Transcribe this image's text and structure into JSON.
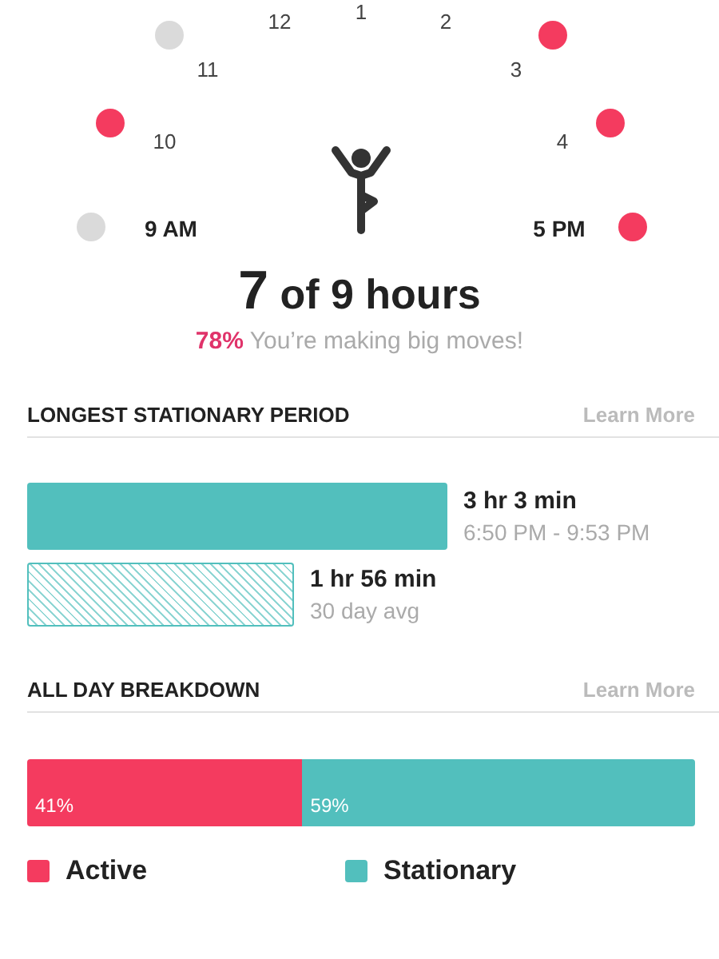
{
  "dial": {
    "hours": [
      {
        "label": "1",
        "kind": "plain"
      },
      {
        "label": "12",
        "kind": "plain"
      },
      {
        "label": "2",
        "kind": "plain"
      },
      {
        "label": "11",
        "kind": "plain"
      },
      {
        "label": "3",
        "kind": "plain"
      },
      {
        "label": "10",
        "kind": "plain"
      },
      {
        "label": "4",
        "kind": "plain"
      },
      {
        "label": "9 AM",
        "kind": "end"
      },
      {
        "label": "5 PM",
        "kind": "end"
      }
    ],
    "dots": [
      {
        "active": false
      },
      {
        "active": true
      },
      {
        "active": false
      },
      {
        "active": true
      },
      {
        "active": true
      },
      {
        "active": true
      }
    ]
  },
  "summary": {
    "count": "7",
    "rest": "of 9 hours",
    "percent": "78%",
    "message": "You’re making big moves!"
  },
  "stationary": {
    "title": "LONGEST STATIONARY PERIOD",
    "link": "Learn More",
    "bars": [
      {
        "kind": "solid",
        "value": "3 hr 3 min",
        "sub": "6:50 PM - 9:53 PM"
      },
      {
        "kind": "hatched",
        "value": "1 hr 56 min",
        "sub": "30 day avg"
      }
    ]
  },
  "breakdown": {
    "title": "ALL DAY BREAKDOWN",
    "link": "Learn More",
    "segments": [
      {
        "label": "Active",
        "percent": "41%",
        "color": "#f43b5f"
      },
      {
        "label": "Stationary",
        "percent": "59%",
        "color": "#52bfbd"
      }
    ]
  }
}
